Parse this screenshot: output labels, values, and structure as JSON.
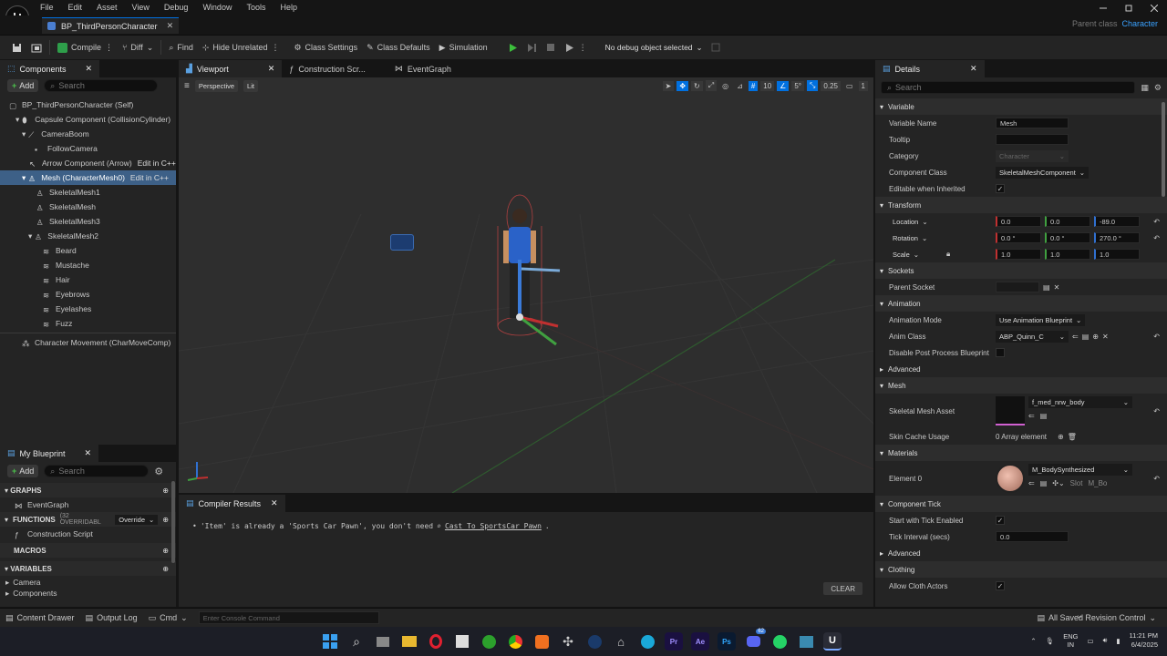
{
  "app": {
    "menu": [
      "File",
      "Edit",
      "Asset",
      "View",
      "Debug",
      "Window",
      "Tools",
      "Help"
    ],
    "tab_title": "BP_ThirdPersonCharacter",
    "parent_class_label": "Parent class",
    "parent_class_value": "Character"
  },
  "toolbar": {
    "compile": "Compile",
    "diff": "Diff",
    "find": "Find",
    "hide_unrelated": "Hide Unrelated",
    "class_settings": "Class Settings",
    "class_defaults": "Class Defaults",
    "simulation": "Simulation",
    "debug_object": "No debug object selected"
  },
  "components": {
    "tab": "Components",
    "add": "Add",
    "search_placeholder": "Search",
    "items": [
      {
        "label": "BP_ThirdPersonCharacter (Self)",
        "indent": 0
      },
      {
        "label": "Capsule Component (CollisionCylinder)",
        "indent": 1
      },
      {
        "label": "CameraBoom",
        "indent": 2
      },
      {
        "label": "FollowCamera",
        "indent": 3
      },
      {
        "label": "Arrow Component (Arrow)",
        "indent": 2
      },
      {
        "label": "Mesh (CharacterMesh0)",
        "indent": 2
      },
      {
        "label": "SkeletalMesh1",
        "indent": 3
      },
      {
        "label": "SkeletalMesh",
        "indent": 3
      },
      {
        "label": "SkeletalMesh3",
        "indent": 3
      },
      {
        "label": "SkeletalMesh2",
        "indent": 3
      },
      {
        "label": "Beard",
        "indent": 4
      },
      {
        "label": "Mustache",
        "indent": 4
      },
      {
        "label": "Hair",
        "indent": 4
      },
      {
        "label": "Eyebrows",
        "indent": 4
      },
      {
        "label": "Eyelashes",
        "indent": 4
      },
      {
        "label": "Fuzz",
        "indent": 4
      },
      {
        "label": "Character Movement (CharMoveComp)",
        "indent": 1
      }
    ],
    "edit_in_cpp": "Edit in C++"
  },
  "my_blueprint": {
    "tab": "My Blueprint",
    "add": "Add",
    "search_placeholder": "Search",
    "graphs": "GRAPHS",
    "event_graph": "EventGraph",
    "functions": "FUNCTIONS",
    "functions_count": "(32 OVERRIDABL",
    "override": "Override",
    "construction_script": "Construction Script",
    "macros": "MACROS",
    "variables": "VARIABLES",
    "camera": "Camera",
    "components": "Components"
  },
  "editor_tabs": [
    "Viewport",
    "Construction Scr...",
    "EventGraph"
  ],
  "viewport": {
    "perspective": "Perspective",
    "lit": "Lit",
    "grid_snap": "10",
    "rot_snap": "5°",
    "scale_snap": "0.25",
    "cam_speed": "1"
  },
  "compiler": {
    "tab": "Compiler Results",
    "message_pre": "'Item' is already a 'Sports Car Pawn', you don't need",
    "message_link": "Cast To SportsCar_Pawn",
    "message_post": ".",
    "clear": "CLEAR"
  },
  "details": {
    "tab": "Details",
    "search_placeholder": "Search",
    "sections": {
      "variable": "Variable",
      "transform": "Transform",
      "sockets": "Sockets",
      "animation": "Animation",
      "advanced": "Advanced",
      "mesh": "Mesh",
      "materials": "Materials",
      "component_tick": "Component Tick",
      "advanced2": "Advanced",
      "clothing": "Clothing"
    },
    "variable_name_label": "Variable Name",
    "variable_name": "Mesh",
    "tooltip_label": "Tooltip",
    "category_label": "Category",
    "category": "Character",
    "component_class_label": "Component Class",
    "component_class": "SkeletalMeshComponent",
    "editable_label": "Editable when Inherited",
    "location_label": "Location",
    "location": [
      "0.0",
      "0.0",
      "-89.0"
    ],
    "rotation_label": "Rotation",
    "rotation": [
      "0.0 °",
      "0.0 °",
      "270.0 °"
    ],
    "scale_label": "Scale",
    "scale": [
      "1.0",
      "1.0",
      "1.0"
    ],
    "parent_socket_label": "Parent Socket",
    "anim_mode_label": "Animation Mode",
    "anim_mode": "Use Animation Blueprint",
    "anim_class_label": "Anim Class",
    "anim_class": "ABP_Quinn_C",
    "disable_pp_label": "Disable Post Process Blueprint",
    "skeletal_mesh_label": "Skeletal Mesh Asset",
    "skeletal_mesh": "f_med_nrw_body",
    "skin_cache_label": "Skin Cache Usage",
    "skin_cache": "0 Array element",
    "element0_label": "Element 0",
    "element0": "M_BodySynthesized",
    "slot_label": "Slot",
    "slot_value": "M_Bo",
    "tick_enabled_label": "Start with Tick Enabled",
    "tick_interval_label": "Tick Interval (secs)",
    "tick_interval": "0.0",
    "allow_cloth_label": "Allow Cloth Actors"
  },
  "statusbar": {
    "content_drawer": "Content Drawer",
    "output_log": "Output Log",
    "cmd": "Cmd",
    "console_placeholder": "Enter Console Command",
    "all_saved": "All Saved",
    "revision_control": "Revision Control"
  },
  "taskbar": {
    "lang1": "ENG",
    "lang2": "IN",
    "time": "11:21 PM",
    "date": "6/4/2025",
    "badge": "62"
  },
  "colors": {
    "accent": "#0070e0",
    "selected_row": "#3d6087",
    "axis_x": "#c03030",
    "axis_y": "#40a040",
    "axis_z": "#3070d0"
  }
}
